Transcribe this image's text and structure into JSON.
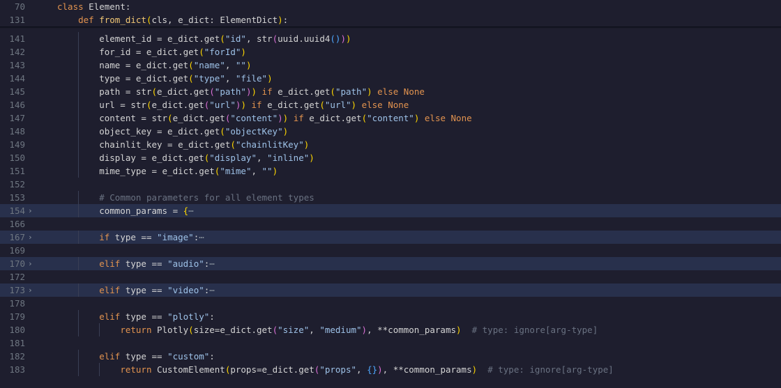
{
  "sticky": [
    {
      "ln": "70",
      "tokens": [
        [
          "class",
          "kw"
        ],
        [
          " Element:",
          "op"
        ]
      ]
    },
    {
      "ln": "131",
      "tokens": [
        [
          "    ",
          "op"
        ],
        [
          "def",
          "kw"
        ],
        [
          " ",
          "op"
        ],
        [
          "from_dict",
          "fn"
        ],
        [
          "(",
          "b1"
        ],
        [
          "cls, e_dict: ElementDict",
          "op"
        ],
        [
          ")",
          "b1"
        ],
        [
          ":",
          "op"
        ]
      ]
    }
  ],
  "lines": [
    {
      "ln": "141",
      "tokens": [
        [
          "        element_id = e_dict.get",
          "op"
        ],
        [
          "(",
          "b1"
        ],
        [
          "\"id\"",
          "str"
        ],
        [
          ", str",
          "op"
        ],
        [
          "(",
          "b2"
        ],
        [
          "uuid.uuid4",
          "op"
        ],
        [
          "()",
          "b3"
        ],
        [
          ")",
          "b2"
        ],
        [
          ")",
          "b1"
        ]
      ]
    },
    {
      "ln": "142",
      "tokens": [
        [
          "        for_id = e_dict.get",
          "op"
        ],
        [
          "(",
          "b1"
        ],
        [
          "\"forId\"",
          "str"
        ],
        [
          ")",
          "b1"
        ]
      ]
    },
    {
      "ln": "143",
      "tokens": [
        [
          "        name = e_dict.get",
          "op"
        ],
        [
          "(",
          "b1"
        ],
        [
          "\"name\"",
          "str"
        ],
        [
          ", ",
          "op"
        ],
        [
          "\"\"",
          "str"
        ],
        [
          ")",
          "b1"
        ]
      ]
    },
    {
      "ln": "144",
      "tokens": [
        [
          "        type = e_dict.get",
          "op"
        ],
        [
          "(",
          "b1"
        ],
        [
          "\"type\"",
          "str"
        ],
        [
          ", ",
          "op"
        ],
        [
          "\"file\"",
          "str"
        ],
        [
          ")",
          "b1"
        ]
      ]
    },
    {
      "ln": "145",
      "tokens": [
        [
          "        path = str",
          "op"
        ],
        [
          "(",
          "b1"
        ],
        [
          "e_dict.get",
          "op"
        ],
        [
          "(",
          "b2"
        ],
        [
          "\"path\"",
          "str"
        ],
        [
          ")",
          "b2"
        ],
        [
          ")",
          "b1"
        ],
        [
          " ",
          "op"
        ],
        [
          "if",
          "kw"
        ],
        [
          " e_dict.get",
          "op"
        ],
        [
          "(",
          "b1"
        ],
        [
          "\"path\"",
          "str"
        ],
        [
          ")",
          "b1"
        ],
        [
          " ",
          "op"
        ],
        [
          "else",
          "kw"
        ],
        [
          " ",
          "op"
        ],
        [
          "None",
          "kw"
        ]
      ]
    },
    {
      "ln": "146",
      "tokens": [
        [
          "        url = str",
          "op"
        ],
        [
          "(",
          "b1"
        ],
        [
          "e_dict.get",
          "op"
        ],
        [
          "(",
          "b2"
        ],
        [
          "\"url\"",
          "str"
        ],
        [
          ")",
          "b2"
        ],
        [
          ")",
          "b1"
        ],
        [
          " ",
          "op"
        ],
        [
          "if",
          "kw"
        ],
        [
          " e_dict.get",
          "op"
        ],
        [
          "(",
          "b1"
        ],
        [
          "\"url\"",
          "str"
        ],
        [
          ")",
          "b1"
        ],
        [
          " ",
          "op"
        ],
        [
          "else",
          "kw"
        ],
        [
          " ",
          "op"
        ],
        [
          "None",
          "kw"
        ]
      ]
    },
    {
      "ln": "147",
      "tokens": [
        [
          "        content = str",
          "op"
        ],
        [
          "(",
          "b1"
        ],
        [
          "e_dict.get",
          "op"
        ],
        [
          "(",
          "b2"
        ],
        [
          "\"content\"",
          "str"
        ],
        [
          ")",
          "b2"
        ],
        [
          ")",
          "b1"
        ],
        [
          " ",
          "op"
        ],
        [
          "if",
          "kw"
        ],
        [
          " e_dict.get",
          "op"
        ],
        [
          "(",
          "b1"
        ],
        [
          "\"content\"",
          "str"
        ],
        [
          ")",
          "b1"
        ],
        [
          " ",
          "op"
        ],
        [
          "else",
          "kw"
        ],
        [
          " ",
          "op"
        ],
        [
          "None",
          "kw"
        ]
      ]
    },
    {
      "ln": "148",
      "tokens": [
        [
          "        object_key = e_dict.get",
          "op"
        ],
        [
          "(",
          "b1"
        ],
        [
          "\"objectKey\"",
          "str"
        ],
        [
          ")",
          "b1"
        ]
      ]
    },
    {
      "ln": "149",
      "tokens": [
        [
          "        chainlit_key = e_dict.get",
          "op"
        ],
        [
          "(",
          "b1"
        ],
        [
          "\"chainlitKey\"",
          "str"
        ],
        [
          ")",
          "b1"
        ]
      ]
    },
    {
      "ln": "150",
      "tokens": [
        [
          "        display = e_dict.get",
          "op"
        ],
        [
          "(",
          "b1"
        ],
        [
          "\"display\"",
          "str"
        ],
        [
          ", ",
          "op"
        ],
        [
          "\"inline\"",
          "str"
        ],
        [
          ")",
          "b1"
        ]
      ]
    },
    {
      "ln": "151",
      "tokens": [
        [
          "        mime_type = e_dict.get",
          "op"
        ],
        [
          "(",
          "b1"
        ],
        [
          "\"mime\"",
          "str"
        ],
        [
          ", ",
          "op"
        ],
        [
          "\"\"",
          "str"
        ],
        [
          ")",
          "b1"
        ]
      ]
    },
    {
      "ln": "152",
      "tokens": []
    },
    {
      "ln": "153",
      "tokens": [
        [
          "        ",
          "op"
        ],
        [
          "# Common parameters for all element types",
          "cm"
        ]
      ]
    },
    {
      "ln": "154",
      "fold": true,
      "hl": true,
      "tokens": [
        [
          "        common_params = ",
          "op"
        ],
        [
          "{",
          "b1"
        ],
        [
          "⋯",
          "ellipsis"
        ]
      ]
    },
    {
      "ln": "166",
      "tokens": []
    },
    {
      "ln": "167",
      "fold": true,
      "hl": true,
      "tokens": [
        [
          "        ",
          "op"
        ],
        [
          "if",
          "kw"
        ],
        [
          " type == ",
          "op"
        ],
        [
          "\"image\"",
          "str"
        ],
        [
          ":",
          "op"
        ],
        [
          "⋯",
          "ellipsis"
        ]
      ]
    },
    {
      "ln": "169",
      "tokens": []
    },
    {
      "ln": "170",
      "fold": true,
      "hl": true,
      "tokens": [
        [
          "        ",
          "op"
        ],
        [
          "elif",
          "kw"
        ],
        [
          " type == ",
          "op"
        ],
        [
          "\"audio\"",
          "str"
        ],
        [
          ":",
          "op"
        ],
        [
          "⋯",
          "ellipsis"
        ]
      ]
    },
    {
      "ln": "172",
      "tokens": []
    },
    {
      "ln": "173",
      "fold": true,
      "hl": true,
      "tokens": [
        [
          "        ",
          "op"
        ],
        [
          "elif",
          "kw"
        ],
        [
          " type == ",
          "op"
        ],
        [
          "\"video\"",
          "str"
        ],
        [
          ":",
          "op"
        ],
        [
          "⋯",
          "ellipsis"
        ]
      ]
    },
    {
      "ln": "178",
      "tokens": []
    },
    {
      "ln": "179",
      "tokens": [
        [
          "        ",
          "op"
        ],
        [
          "elif",
          "kw"
        ],
        [
          " type == ",
          "op"
        ],
        [
          "\"plotly\"",
          "str"
        ],
        [
          ":",
          "op"
        ]
      ]
    },
    {
      "ln": "180",
      "tokens": [
        [
          "            ",
          "op"
        ],
        [
          "return",
          "kw"
        ],
        [
          " Plotly",
          "op"
        ],
        [
          "(",
          "b1"
        ],
        [
          "size=e_dict.get",
          "op"
        ],
        [
          "(",
          "b2"
        ],
        [
          "\"size\"",
          "str"
        ],
        [
          ", ",
          "op"
        ],
        [
          "\"medium\"",
          "str"
        ],
        [
          ")",
          "b2"
        ],
        [
          ", **common_params",
          "op"
        ],
        [
          ")",
          "b1"
        ],
        [
          "  ",
          "op"
        ],
        [
          "# type: ignore[arg-type]",
          "cm"
        ]
      ]
    },
    {
      "ln": "181",
      "tokens": []
    },
    {
      "ln": "182",
      "tokens": [
        [
          "        ",
          "op"
        ],
        [
          "elif",
          "kw"
        ],
        [
          " type == ",
          "op"
        ],
        [
          "\"custom\"",
          "str"
        ],
        [
          ":",
          "op"
        ]
      ]
    },
    {
      "ln": "183",
      "tokens": [
        [
          "            ",
          "op"
        ],
        [
          "return",
          "kw"
        ],
        [
          " CustomElement",
          "op"
        ],
        [
          "(",
          "b1"
        ],
        [
          "props=e_dict.get",
          "op"
        ],
        [
          "(",
          "b2"
        ],
        [
          "\"props\"",
          "str"
        ],
        [
          ", ",
          "op"
        ],
        [
          "{}",
          "b3"
        ],
        [
          ")",
          "b2"
        ],
        [
          ", **common_params",
          "op"
        ],
        [
          ")",
          "b1"
        ],
        [
          "  ",
          "op"
        ],
        [
          "# type: ignore[arg-type]",
          "cm"
        ]
      ]
    }
  ],
  "colors": {
    "background": "#1e1e2e",
    "highlight": "#28304c",
    "keyword": "#e2934f",
    "function": "#f0c674",
    "string": "#9ec2e8",
    "comment": "#6a7282"
  },
  "icons": {
    "fold": "chevron-right-icon",
    "ellipsis": "ellipsis-icon"
  }
}
